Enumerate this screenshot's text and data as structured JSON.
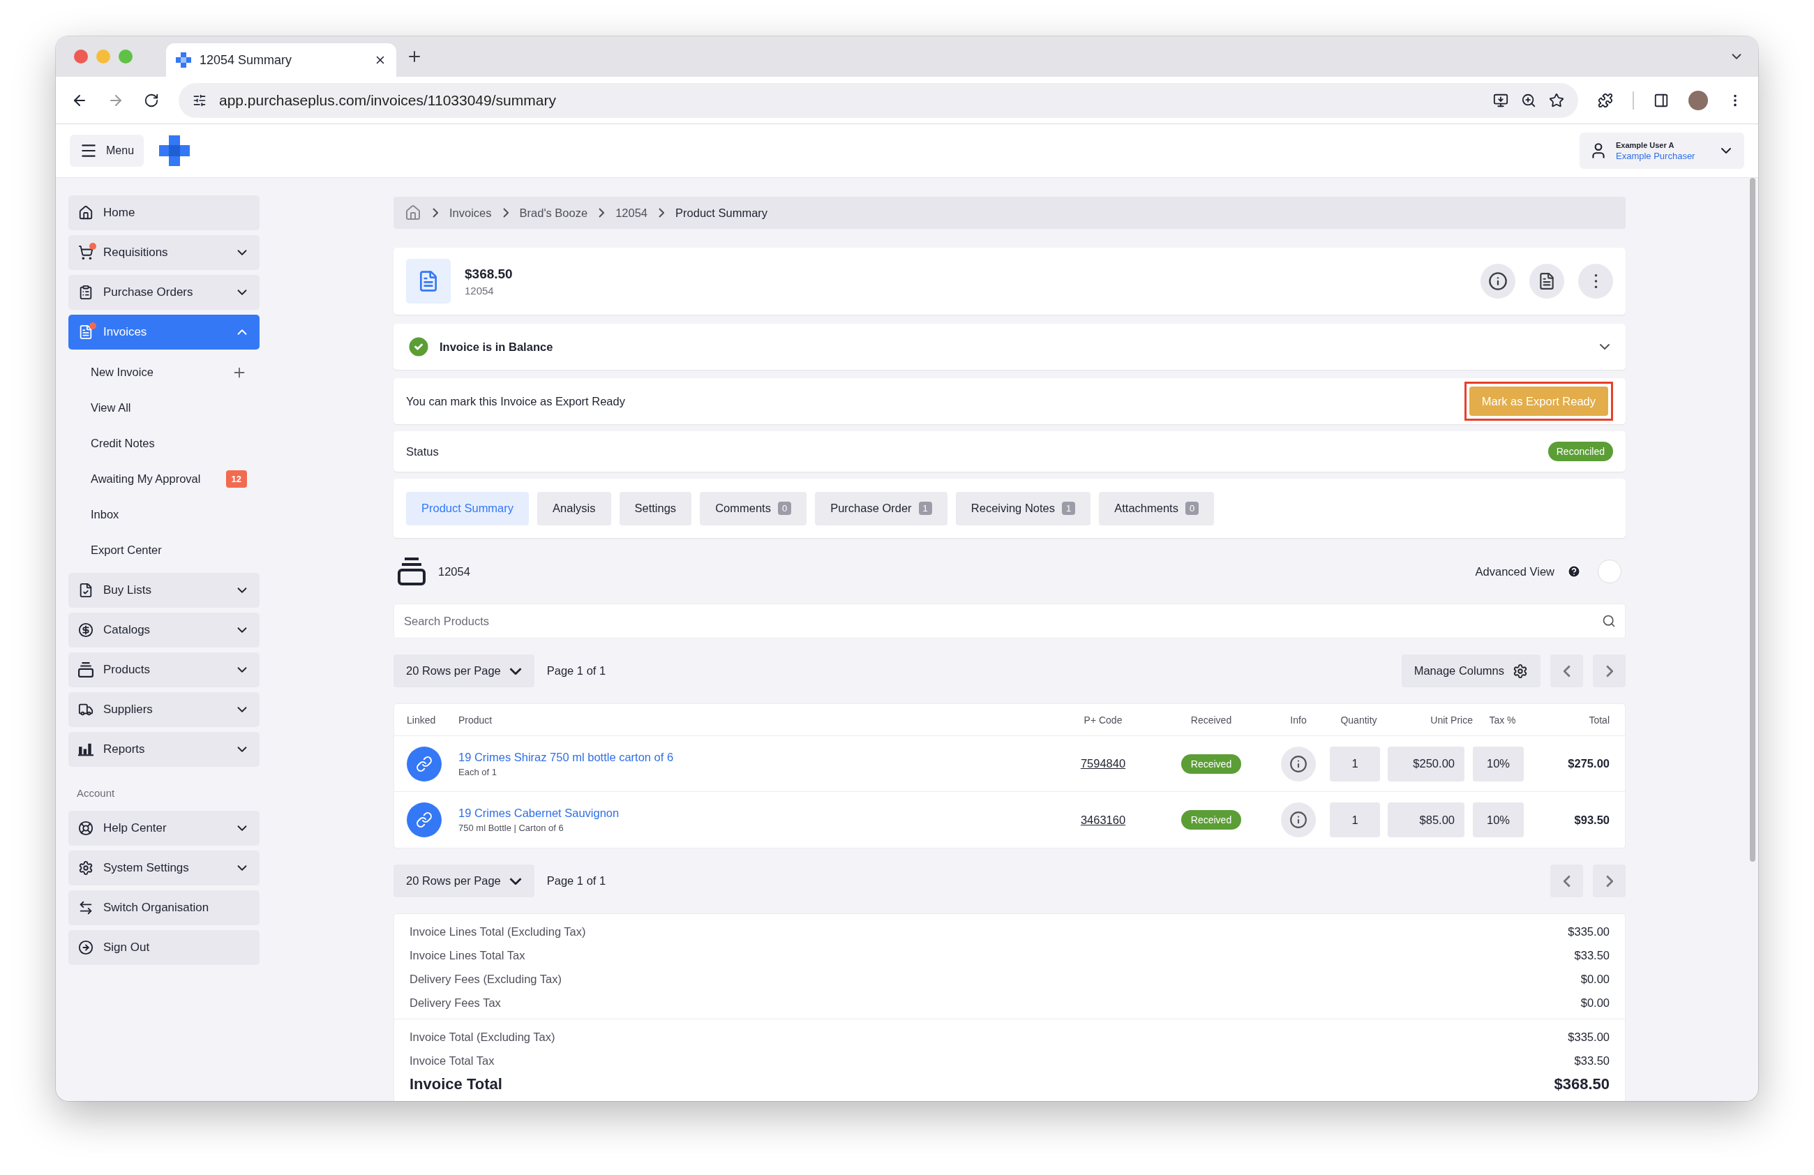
{
  "browser": {
    "tab_title": "12054 Summary",
    "url": "app.purchaseplus.com/invoices/11033049/summary"
  },
  "header": {
    "menu_label": "Menu",
    "user_name": "Example User A",
    "user_role": "Example Purchaser"
  },
  "sidebar": {
    "items": [
      {
        "label": "Home",
        "kind": "link",
        "notify": false,
        "selected": false
      },
      {
        "label": "Requisitions",
        "kind": "menu",
        "notify": true,
        "selected": false,
        "expanded": false
      },
      {
        "label": "Purchase Orders",
        "kind": "menu",
        "notify": false,
        "selected": false,
        "expanded": false
      },
      {
        "label": "Invoices",
        "kind": "menu",
        "notify": true,
        "selected": true,
        "expanded": true,
        "children": [
          {
            "label": "New Invoice",
            "kind": "add"
          },
          {
            "label": "View All",
            "kind": "link"
          },
          {
            "label": "Credit Notes",
            "kind": "link"
          },
          {
            "label": "Awaiting My Approval",
            "kind": "count",
            "badge": "12"
          },
          {
            "label": "Inbox",
            "kind": "link"
          },
          {
            "label": "Export Center",
            "kind": "link"
          }
        ]
      },
      {
        "label": "Buy Lists",
        "kind": "menu",
        "notify": false,
        "selected": false,
        "expanded": false
      },
      {
        "label": "Catalogs",
        "kind": "menu",
        "notify": false,
        "selected": false,
        "expanded": false
      },
      {
        "label": "Products",
        "kind": "menu",
        "notify": false,
        "selected": false,
        "expanded": false
      },
      {
        "label": "Suppliers",
        "kind": "menu",
        "notify": false,
        "selected": false,
        "expanded": false
      },
      {
        "label": "Reports",
        "kind": "menu",
        "notify": false,
        "selected": false,
        "expanded": false
      }
    ],
    "account_label": "Account",
    "account_items": [
      {
        "label": "Help Center",
        "kind": "menu",
        "notify": false,
        "selected": false,
        "expanded": false
      },
      {
        "label": "System Settings",
        "kind": "menu",
        "notify": false,
        "selected": false,
        "expanded": false
      },
      {
        "label": "Switch Organisation",
        "kind": "link",
        "notify": false,
        "selected": false
      },
      {
        "label": "Sign Out",
        "kind": "link",
        "notify": false,
        "selected": false
      }
    ]
  },
  "breadcrumb": [
    "Invoices",
    "Brad's Booze",
    "12054",
    "Product Summary"
  ],
  "invoice": {
    "amount": "$368.50",
    "number": "12054"
  },
  "balance": {
    "text": "Invoice is in Balance"
  },
  "export_notice": {
    "text": "You can mark this Invoice as Export Ready",
    "button": "Mark as Export Ready",
    "highlighted": true
  },
  "status": {
    "label": "Status",
    "badge": "Reconciled"
  },
  "tabs": [
    {
      "label": "Product Summary",
      "selected": true
    },
    {
      "label": "Analysis",
      "selected": false
    },
    {
      "label": "Settings",
      "selected": false
    },
    {
      "label": "Comments",
      "count": "0",
      "selected": false
    },
    {
      "label": "Purchase Order",
      "count": "1",
      "selected": false
    },
    {
      "label": "Receiving Notes",
      "count": "1",
      "selected": false
    },
    {
      "label": "Attachments",
      "count": "0",
      "selected": false
    }
  ],
  "list_header": {
    "title": "12054",
    "advanced_view_label": "Advanced View",
    "advanced_view_on": false
  },
  "search": {
    "placeholder": "Search Products"
  },
  "pager": {
    "rows_per_page": "20 Rows per Page",
    "page": "Page 1 of 1",
    "manage_columns": "Manage Columns"
  },
  "table": {
    "columns": [
      "Linked",
      "Product",
      "P+ Code",
      "Received",
      "Info",
      "Quantity",
      "Unit Price",
      "Tax %",
      "Total"
    ],
    "rows": [
      {
        "product": "19 Crimes Shiraz 750 ml bottle carton of 6",
        "detail": "Each of 1",
        "code": "7594840",
        "received": "Received",
        "quantity": "1",
        "unit_price": "$250.00",
        "tax": "10%",
        "total": "$275.00"
      },
      {
        "product": "19 Crimes Cabernet Sauvignon",
        "detail": "750 ml Bottle | Carton of 6",
        "code": "3463160",
        "received": "Received",
        "quantity": "1",
        "unit_price": "$85.00",
        "tax": "10%",
        "total": "$93.50"
      }
    ]
  },
  "bottom_pager": {
    "rows_per_page": "20 Rows per Page",
    "page": "Page 1 of 1"
  },
  "totals": {
    "groups": [
      [
        {
          "label": "Invoice Lines Total (Excluding Tax)",
          "value": "$335.00"
        },
        {
          "label": "Invoice Lines Total Tax",
          "value": "$33.50"
        },
        {
          "label": "Delivery Fees (Excluding Tax)",
          "value": "$0.00"
        },
        {
          "label": "Delivery Fees Tax",
          "value": "$0.00"
        }
      ],
      [
        {
          "label": "Invoice Total (Excluding Tax)",
          "value": "$335.00"
        },
        {
          "label": "Invoice Total Tax",
          "value": "$33.50"
        }
      ]
    ],
    "grand": {
      "label": "Invoice Total",
      "value": "$368.50"
    }
  }
}
